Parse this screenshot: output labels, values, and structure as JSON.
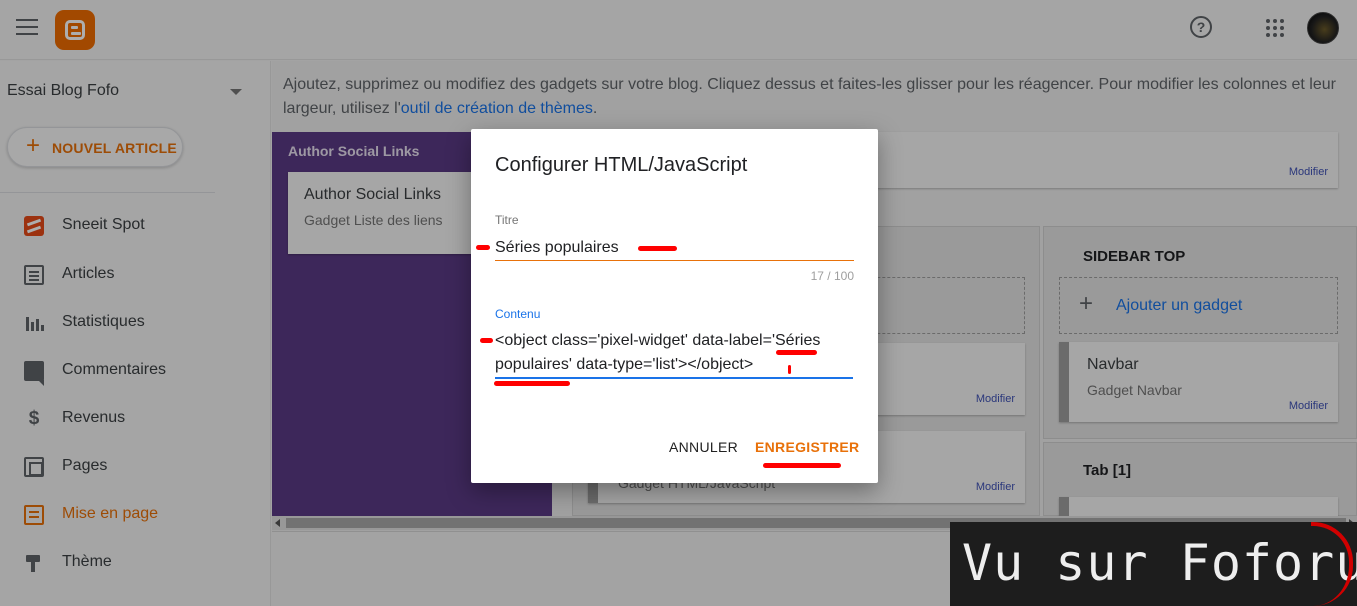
{
  "topbar": {
    "help_icon": "?"
  },
  "sidebar": {
    "blog_name": "Essai Blog Fofo",
    "new_post_label": "NOUVEL ARTICLE",
    "items": [
      {
        "label": "Sneeit Spot",
        "icon": "sneeit-icon"
      },
      {
        "label": "Articles",
        "icon": "article-icon"
      },
      {
        "label": "Statistiques",
        "icon": "stats-icon"
      },
      {
        "label": "Commentaires",
        "icon": "comment-icon"
      },
      {
        "label": "Revenus",
        "icon": "dollar-icon"
      },
      {
        "label": "Pages",
        "icon": "pages-icon"
      },
      {
        "label": "Mise en page",
        "icon": "layout-icon",
        "active": true
      },
      {
        "label": "Thème",
        "icon": "theme-icon"
      }
    ]
  },
  "main": {
    "info_text": "Ajoutez, supprimez ou modifiez des gadgets sur votre blog. Cliquez dessus et faites-les glisser pour les réagencer. Pour modifier les colonnes et leur largeur, utilisez l'",
    "info_link": "outil de création de thèmes",
    "info_end": ".",
    "author_panel_title": "Author Social Links",
    "author_card": {
      "title": "Author Social Links",
      "subtitle": "Gadget Liste des liens"
    },
    "edit_label": "Modifier",
    "sidebar_top": {
      "title": "SIDEBAR TOP",
      "add_gadget": "Ajouter un gadget",
      "navbar_card": {
        "title": "Navbar",
        "subtitle": "Gadget Navbar"
      }
    },
    "tab_panel_title": "Tab [1]",
    "partial_card_subtitle": "Gadget HTML/JavaScript"
  },
  "dialog": {
    "title": "Configurer HTML/JavaScript",
    "title_field_label": "Titre",
    "title_value": "Séries populaires",
    "char_count": "17 / 100",
    "content_field_label": "Contenu",
    "content_value": "<object class='pixel-widget' data-label='Séries populaires' data-type='list'></object>",
    "cancel_label": "ANNULER",
    "save_label": "ENREGISTRER"
  },
  "watermark": {
    "text": "Vu sur Foforum"
  },
  "colors": {
    "accent": "#e8710a",
    "link": "#1a73e8",
    "purple_panel": "#5b3a85",
    "annotation": "#ff0000"
  }
}
